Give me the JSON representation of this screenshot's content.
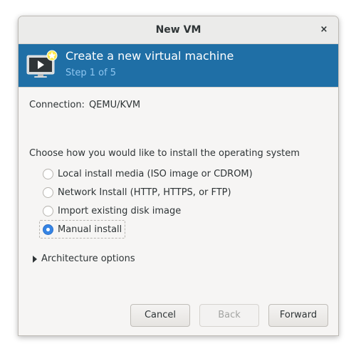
{
  "window": {
    "title": "New VM",
    "close_label": "×"
  },
  "banner": {
    "title": "Create a new virtual machine",
    "step": "Step 1 of 5",
    "icon": "vm-monitor-star-icon",
    "background": "#1f6fa6"
  },
  "connection": {
    "label": "Connection:",
    "value": "QEMU/KVM"
  },
  "install": {
    "prompt": "Choose how you would like to install the operating system",
    "options": [
      {
        "label": "Local install media (ISO image or CDROM)",
        "selected": false
      },
      {
        "label": "Network Install (HTTP, HTTPS, or FTP)",
        "selected": false
      },
      {
        "label": "Import existing disk image",
        "selected": false
      },
      {
        "label": "Manual install",
        "selected": true
      }
    ]
  },
  "architecture": {
    "label": "Architecture options",
    "expanded": false
  },
  "buttons": {
    "cancel": "Cancel",
    "back": "Back",
    "forward": "Forward"
  },
  "colors": {
    "accent": "#3584e4",
    "step_text": "#8fc6f0"
  }
}
